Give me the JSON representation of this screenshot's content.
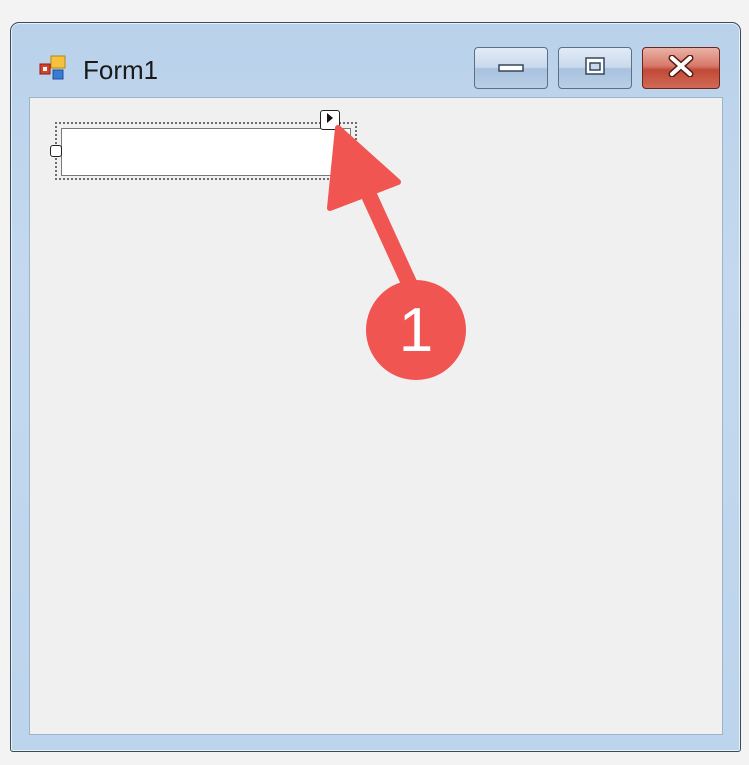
{
  "window": {
    "title": "Form1",
    "icon": "winforms-form-icon",
    "controls": {
      "minimize_icon": "minimize-icon",
      "maximize_icon": "maximize-icon",
      "close_icon": "close-icon"
    }
  },
  "designer": {
    "textbox": {
      "value": ""
    },
    "smart_tag_icon": "smart-tag-arrow-icon"
  },
  "annotation": {
    "step_label": "1",
    "color": "#f05552"
  }
}
